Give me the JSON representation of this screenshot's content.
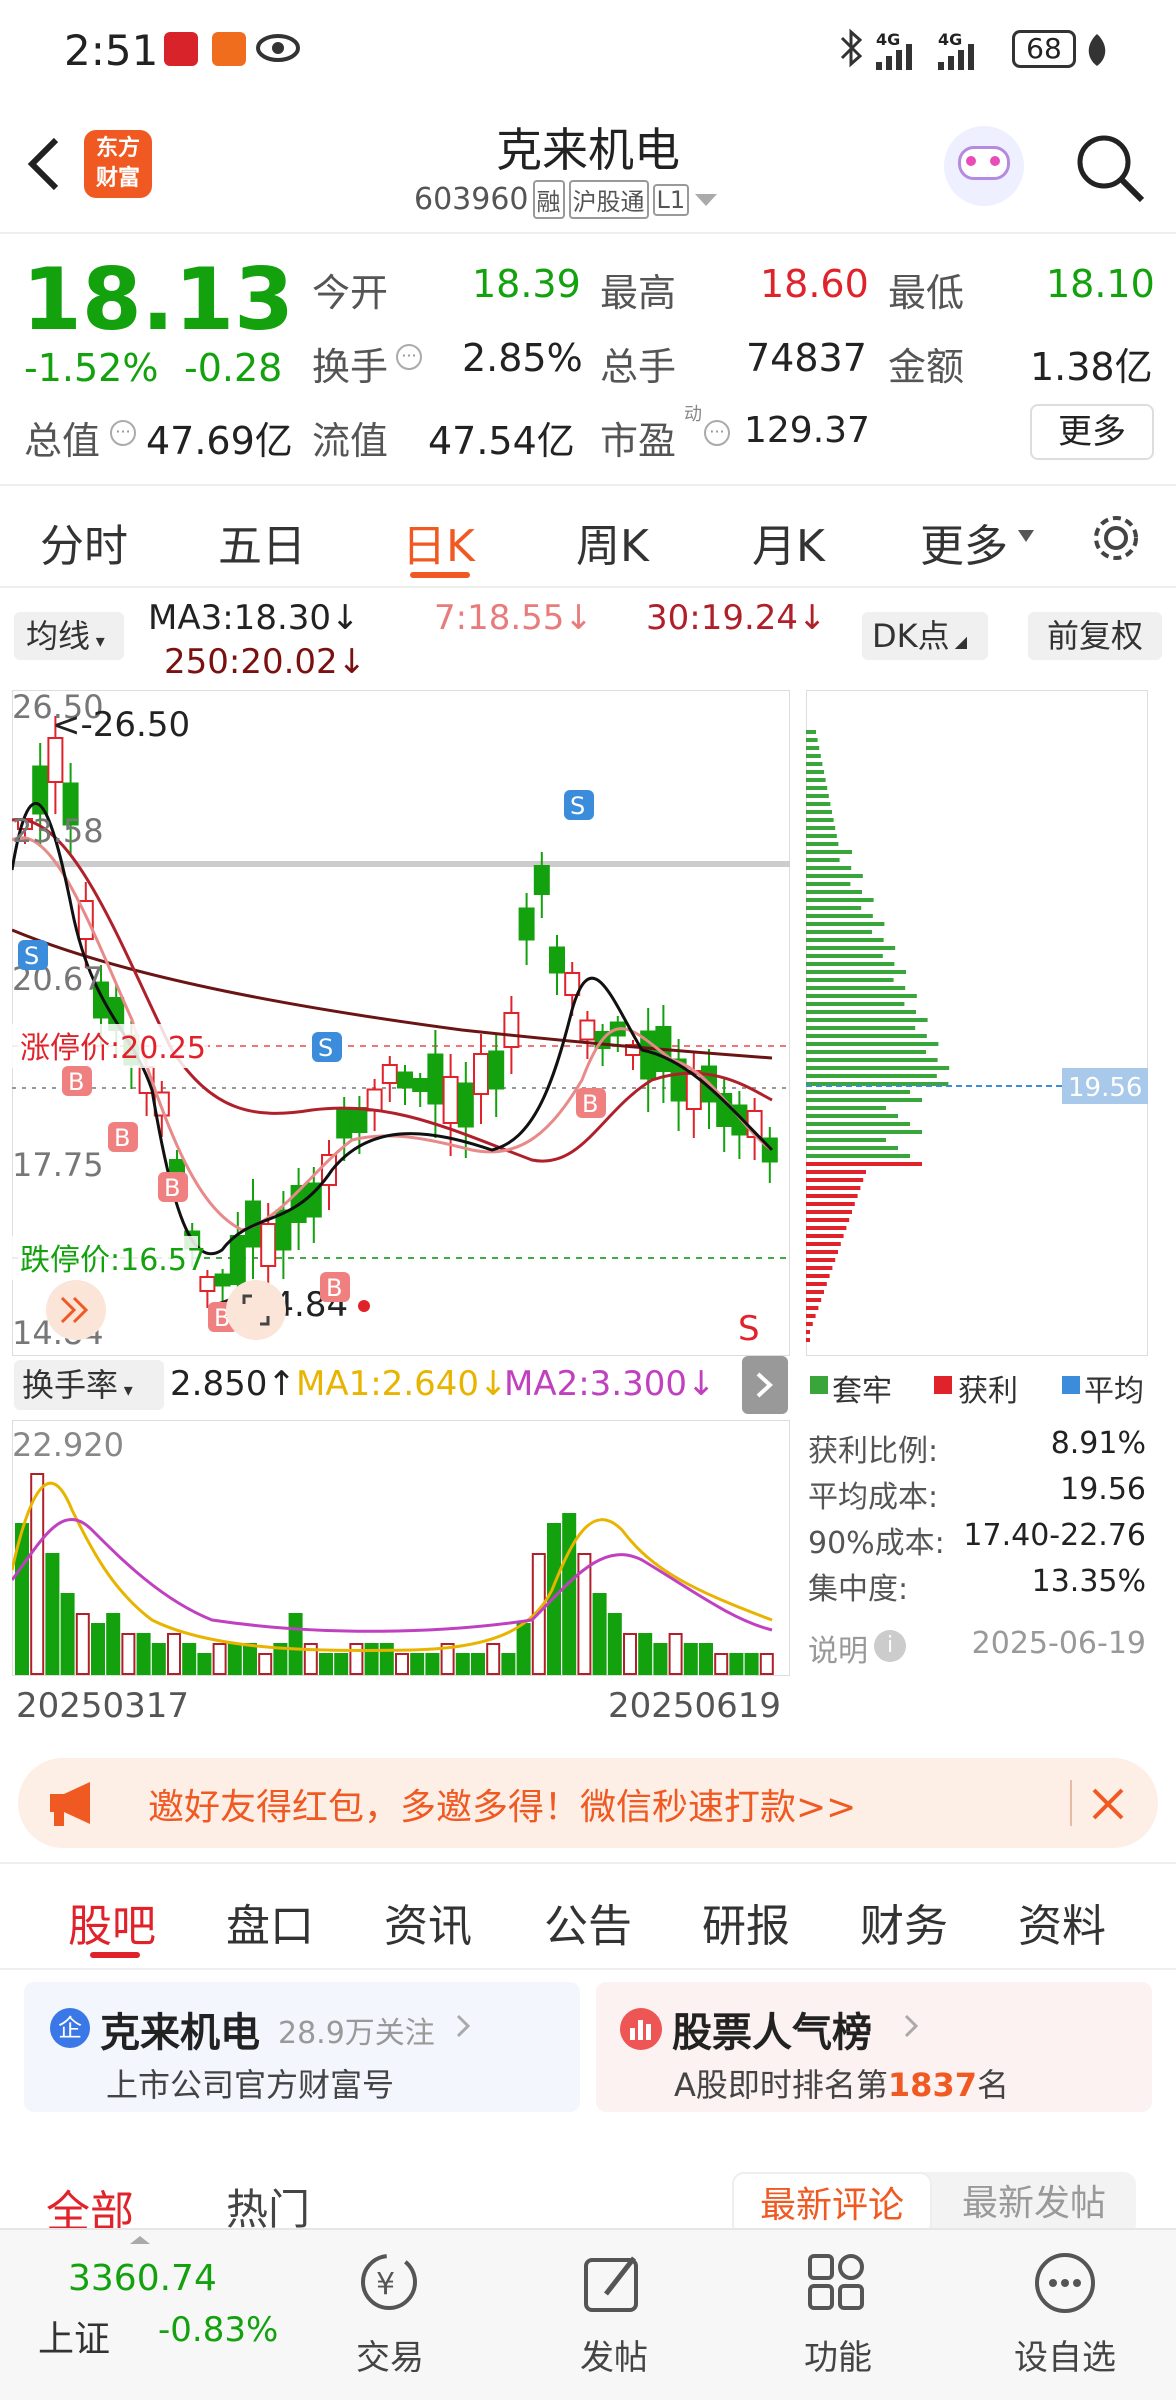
{
  "status": {
    "time": "2:51",
    "net1": "4G",
    "net2": "4G",
    "battery": "68"
  },
  "header": {
    "title": "克来机电",
    "code": "603960",
    "tag1": "融",
    "tag2": "沪股通",
    "tag3": "L1"
  },
  "quote": {
    "price": "18.13",
    "pct": "-1.52%",
    "chg": "-0.28",
    "open_l": "今开",
    "open_v": "18.39",
    "high_l": "最高",
    "high_v": "18.60",
    "low_l": "最低",
    "low_v": "18.10",
    "turn_l": "换手",
    "turn_v": "2.85%",
    "vol_l": "总手",
    "vol_v": "74837",
    "amt_l": "金额",
    "amt_v": "1.38亿",
    "mcap_l": "总值",
    "mcap_v": "47.69亿",
    "fcap_l": "流值",
    "fcap_v": "47.54亿",
    "pe_l": "市盈",
    "pe_sup": "动",
    "pe_v": "129.37",
    "more": "更多"
  },
  "period_tabs": [
    "分时",
    "五日",
    "日K",
    "周K",
    "月K",
    "更多"
  ],
  "ma_bar": {
    "select": "均线",
    "ma3": "MA3:18.30↓",
    "ma7": "7:18.55↓",
    "ma30": "30:19.24↓",
    "ma250": "250:20.02↓",
    "dk": "DK点",
    "fq": "前复权"
  },
  "kline": {
    "y_labels": [
      "26.50",
      "23.58",
      "20.67",
      "17.75",
      "14.84"
    ],
    "max_note": "<-26.50",
    "min_note": "<-14.84",
    "limit_up": "涨停价:20.25",
    "limit_down": "跌停价:16.57",
    "s_marker": "S",
    "b_marker": "B"
  },
  "chart_data": {
    "type": "candlestick",
    "title": "",
    "ylim": [
      14.84,
      26.5
    ],
    "y_ticks": [
      26.5,
      23.58,
      20.67,
      17.75,
      14.84
    ],
    "start_date": "20250317",
    "end_date": "20250619",
    "ma_series": [
      {
        "name": "MA3",
        "last": 18.3
      },
      {
        "name": "MA7",
        "last": 18.55
      },
      {
        "name": "MA30",
        "last": 19.24
      },
      {
        "name": "MA250",
        "last": 20.02
      }
    ],
    "limit_up": 20.25,
    "limit_down": 16.57,
    "max": 26.5,
    "min": 14.84,
    "turnover": {
      "name": "换手率",
      "last": 2.85,
      "ma1": 2.64,
      "ma2": 3.3,
      "ymax": 22.92
    },
    "chip": {
      "avg": 19.56
    }
  },
  "indicator": {
    "select": "换手率",
    "value": "2.850↑",
    "ma1": "MA1:2.640↓",
    "ma2": "MA2:3.300↓",
    "top": "22.920"
  },
  "dates": {
    "start": "20250317",
    "end": "20250619"
  },
  "chip": {
    "legend": [
      "套牢",
      "获利",
      "平均"
    ],
    "avg_label": "19.56",
    "rows": [
      {
        "k": "获利比例:",
        "v": "8.91%"
      },
      {
        "k": "平均成本:",
        "v": "19.56"
      },
      {
        "k": "90%成本:",
        "v": "17.40-22.76"
      },
      {
        "k": "集中度:",
        "v": "13.35%"
      }
    ],
    "note": "说明",
    "date": "2025-06-19"
  },
  "banner": {
    "text": "邀好友得红包，多邀多得！微信秒速打款>>"
  },
  "section_tabs": [
    "股吧",
    "盘口",
    "资讯",
    "公告",
    "研报",
    "财务",
    "资料"
  ],
  "cards": {
    "left_title": "克来机电",
    "left_follow": "28.9万关注",
    "left_sub": "上市公司官方财富号",
    "right_title": "股票人气榜",
    "right_sub_pre": "A股即时排名第",
    "right_rank": "1837",
    "right_sub_post": "名"
  },
  "filter": {
    "all": "全部",
    "hot": "热门",
    "new_comment": "最新评论",
    "new_post": "最新发帖"
  },
  "bottom": {
    "index_val": "3360.74",
    "index_name": "上证",
    "index_pct": "-0.83%",
    "trade": "交易",
    "post": "发帖",
    "func": "功能",
    "watch": "设自选"
  }
}
